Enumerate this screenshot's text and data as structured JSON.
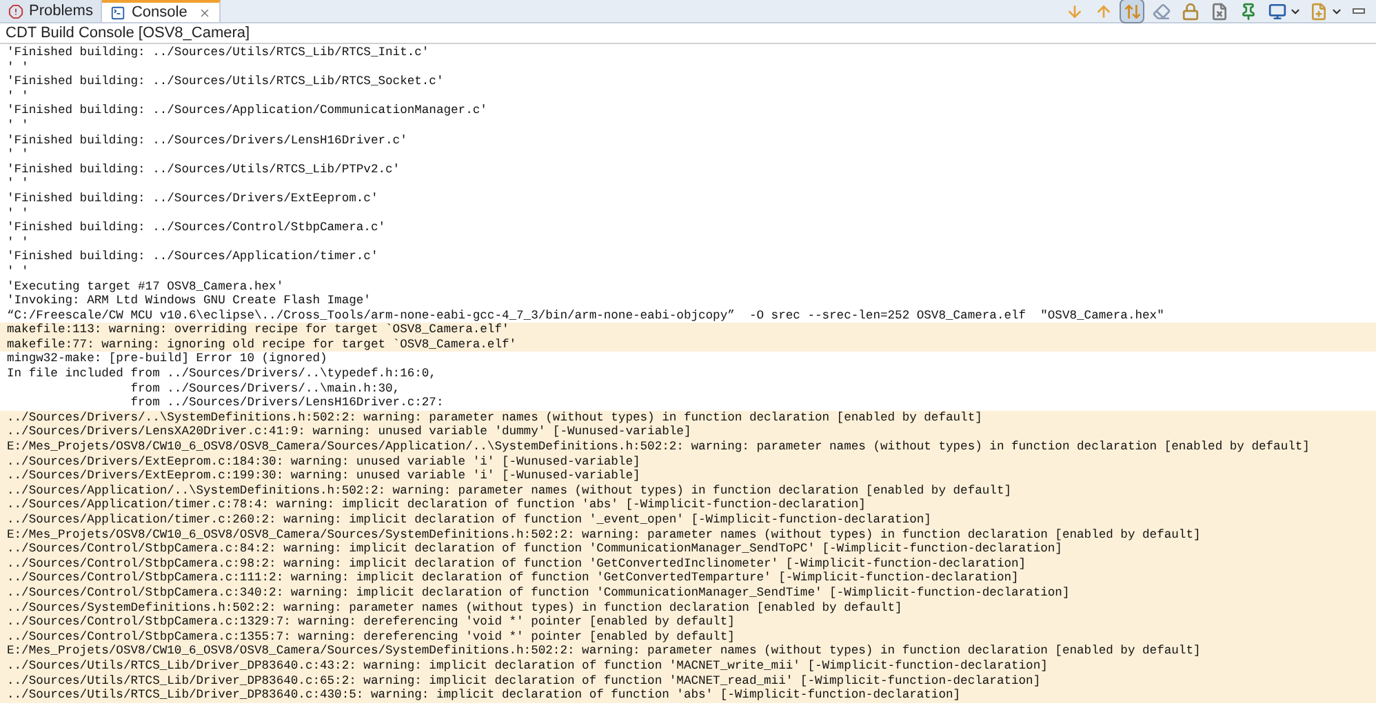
{
  "tabs": [
    {
      "label": "Problems",
      "selected": false,
      "closable": false
    },
    {
      "label": "Console",
      "selected": true,
      "closable": true
    }
  ],
  "toolbar": [
    {
      "kind": "arrow-down",
      "selected": false
    },
    {
      "kind": "arrow-up",
      "selected": false
    },
    {
      "kind": "scroll-lock",
      "selected": true
    },
    {
      "kind": "clear",
      "selected": false
    },
    {
      "kind": "lock",
      "selected": false
    },
    {
      "kind": "remove",
      "selected": false
    },
    {
      "kind": "pin",
      "selected": false
    },
    {
      "kind": "monitor",
      "selected": false
    },
    {
      "kind": "new",
      "selected": false
    }
  ],
  "console": {
    "title": "CDT Build Console [OSV8_Camera]",
    "lines": [
      {
        "kind": "output",
        "text": "'Finished building: ../Sources/Utils/RTCS_Lib/RTCS_Init.c'"
      },
      {
        "kind": "output",
        "text": "' '"
      },
      {
        "kind": "output",
        "text": "'Finished building: ../Sources/Utils/RTCS_Lib/RTCS_Socket.c'"
      },
      {
        "kind": "output",
        "text": "' '"
      },
      {
        "kind": "output",
        "text": "'Finished building: ../Sources/Application/CommunicationManager.c'"
      },
      {
        "kind": "output",
        "text": "' '"
      },
      {
        "kind": "output",
        "text": "'Finished building: ../Sources/Drivers/LensH16Driver.c'"
      },
      {
        "kind": "output",
        "text": "' '"
      },
      {
        "kind": "output",
        "text": "'Finished building: ../Sources/Utils/RTCS_Lib/PTPv2.c'"
      },
      {
        "kind": "output",
        "text": "' '"
      },
      {
        "kind": "output",
        "text": "'Finished building: ../Sources/Drivers/ExtEeprom.c'"
      },
      {
        "kind": "output",
        "text": "' '"
      },
      {
        "kind": "output",
        "text": "'Finished building: ../Sources/Control/StbpCamera.c'"
      },
      {
        "kind": "output",
        "text": "' '"
      },
      {
        "kind": "output",
        "text": "'Finished building: ../Sources/Application/timer.c'"
      },
      {
        "kind": "output",
        "text": "' '"
      },
      {
        "kind": "output",
        "text": "'Executing target #17 OSV8_Camera.hex'"
      },
      {
        "kind": "output",
        "text": "'Invoking: ARM Ltd Windows GNU Create Flash Image'"
      },
      {
        "kind": "output",
        "text": "“C:/Freescale/CW MCU v10.6\\eclipse\\../Cross_Tools/arm-none-eabi-gcc-4_7_3/bin/arm-none-eabi-objcopy”  -O srec --srec-len=252 OSV8_Camera.elf  \"OSV8_Camera.hex\""
      },
      {
        "kind": "warning",
        "text": "makefile:113: warning: overriding recipe for target `OSV8_Camera.elf'"
      },
      {
        "kind": "warning",
        "text": "makefile:77: warning: ignoring old recipe for target `OSV8_Camera.elf'"
      },
      {
        "kind": "output",
        "text": "mingw32-make: [pre-build] Error 10 (ignored)"
      },
      {
        "kind": "output",
        "text": "In file included from ../Sources/Drivers/..\\typedef.h:16:0,"
      },
      {
        "kind": "output",
        "text": "                 from ../Sources/Drivers/..\\main.h:30,"
      },
      {
        "kind": "output",
        "text": "                 from ../Sources/Drivers/LensH16Driver.c:27:"
      },
      {
        "kind": "warning",
        "text": "../Sources/Drivers/..\\SystemDefinitions.h:502:2: warning: parameter names (without types) in function declaration [enabled by default]"
      },
      {
        "kind": "warning",
        "text": "../Sources/Drivers/LensXA20Driver.c:41:9: warning: unused variable 'dummy' [-Wunused-variable]"
      },
      {
        "kind": "warning",
        "text": "E:/Mes_Projets/OSV8/CW10_6_OSV8/OSV8_Camera/Sources/Application/..\\SystemDefinitions.h:502:2: warning: parameter names (without types) in function declaration [enabled by default]"
      },
      {
        "kind": "warning",
        "text": "../Sources/Drivers/ExtEeprom.c:184:30: warning: unused variable 'i' [-Wunused-variable]"
      },
      {
        "kind": "warning",
        "text": "../Sources/Drivers/ExtEeprom.c:199:30: warning: unused variable 'i' [-Wunused-variable]"
      },
      {
        "kind": "warning",
        "text": "../Sources/Application/..\\SystemDefinitions.h:502:2: warning: parameter names (without types) in function declaration [enabled by default]"
      },
      {
        "kind": "warning",
        "text": "../Sources/Application/timer.c:78:4: warning: implicit declaration of function 'abs' [-Wimplicit-function-declaration]"
      },
      {
        "kind": "warning",
        "text": "../Sources/Application/timer.c:260:2: warning: implicit declaration of function '_event_open' [-Wimplicit-function-declaration]"
      },
      {
        "kind": "warning",
        "text": "E:/Mes_Projets/OSV8/CW10_6_OSV8/OSV8_Camera/Sources/SystemDefinitions.h:502:2: warning: parameter names (without types) in function declaration [enabled by default]"
      },
      {
        "kind": "warning",
        "text": "../Sources/Control/StbpCamera.c:84:2: warning: implicit declaration of function 'CommunicationManager_SendToPC' [-Wimplicit-function-declaration]"
      },
      {
        "kind": "warning",
        "text": "../Sources/Control/StbpCamera.c:98:2: warning: implicit declaration of function 'GetConvertedInclinometer' [-Wimplicit-function-declaration]"
      },
      {
        "kind": "warning",
        "text": "../Sources/Control/StbpCamera.c:111:2: warning: implicit declaration of function 'GetConvertedTemparture' [-Wimplicit-function-declaration]"
      },
      {
        "kind": "warning",
        "text": "../Sources/Control/StbpCamera.c:340:2: warning: implicit declaration of function 'CommunicationManager_SendTime' [-Wimplicit-function-declaration]"
      },
      {
        "kind": "warning",
        "text": "../Sources/SystemDefinitions.h:502:2: warning: parameter names (without types) in function declaration [enabled by default]"
      },
      {
        "kind": "warning",
        "text": "../Sources/Control/StbpCamera.c:1329:7: warning: dereferencing 'void *' pointer [enabled by default]"
      },
      {
        "kind": "warning",
        "text": "../Sources/Control/StbpCamera.c:1355:7: warning: dereferencing 'void *' pointer [enabled by default]"
      },
      {
        "kind": "warning",
        "text": "E:/Mes_Projets/OSV8/CW10_6_OSV8/OSV8_Camera/Sources/SystemDefinitions.h:502:2: warning: parameter names (without types) in function declaration [enabled by default]"
      },
      {
        "kind": "warning",
        "text": "../Sources/Utils/RTCS_Lib/Driver_DP83640.c:43:2: warning: implicit declaration of function 'MACNET_write_mii' [-Wimplicit-function-declaration]"
      },
      {
        "kind": "warning",
        "text": "../Sources/Utils/RTCS_Lib/Driver_DP83640.c:65:2: warning: implicit declaration of function 'MACNET_read_mii' [-Wimplicit-function-declaration]"
      },
      {
        "kind": "warning",
        "text": "../Sources/Utils/RTCS_Lib/Driver_DP83640.c:430:5: warning: implicit declaration of function 'abs' [-Wimplicit-function-declaration]"
      }
    ]
  }
}
